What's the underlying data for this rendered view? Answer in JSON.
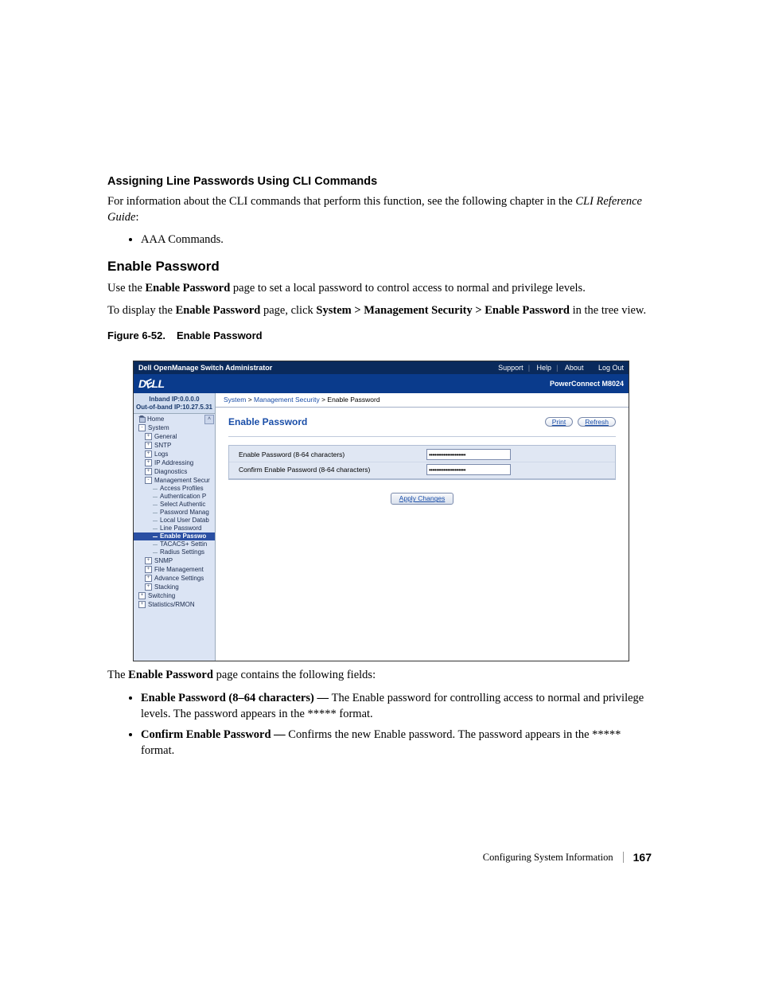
{
  "section1_heading": "Assigning Line Passwords Using CLI Commands",
  "section1_p1a": "For information about the CLI commands that perform this function, see the following chapter in the ",
  "section1_p1b": "CLI Reference Guide",
  "section1_p1c": ":",
  "section1_bullet1": "AAA Commands.",
  "section2_heading": "Enable Password",
  "section2_p1a": "Use the ",
  "section2_p1b": "Enable Password",
  "section2_p1c": " page to set a local password to control access to normal and privilege levels.",
  "section2_p2a": "To display the ",
  "section2_p2b": "Enable Password",
  "section2_p2c": " page, click ",
  "section2_p2d": "System > Management Security > Enable Password",
  "section2_p2e": " in the tree view.",
  "figcap_a": "Figure 6-52.",
  "figcap_b": "Enable Password",
  "shot": {
    "topbar_title": "Dell OpenManage Switch Administrator",
    "top_links": {
      "support": "Support",
      "help": "Help",
      "about": "About",
      "logout": "Log Out"
    },
    "model": "PowerConnect M8024",
    "ip": {
      "inband": "Inband IP:0.0.0.0",
      "oob": "Out-of-band IP:10.27.5.31"
    },
    "tree": {
      "home": "Home",
      "system": "System",
      "general": "General",
      "sntp": "SNTP",
      "logs": "Logs",
      "ipaddr": "IP Addressing",
      "diag": "Diagnostics",
      "mgmtsec": "Management Secur",
      "access": "Access Profiles",
      "authp": "Authentication P",
      "selectauth": "Select Authentic",
      "pwdmgr": "Password Manag",
      "localuser": "Local User Datab",
      "linepwd": "Line Password",
      "enablepwd": "Enable Passwo",
      "tacacs": "TACACS+ Settin",
      "radius": "Radius Settings",
      "snmp": "SNMP",
      "filemgmt": "File Management",
      "advset": "Advance Settings",
      "stacking": "Stacking",
      "switching": "Switching",
      "stats": "Statistics/RMON"
    },
    "crumb": {
      "a": "System",
      "b": "Management Security",
      "c": "Enable Password"
    },
    "content": {
      "title": "Enable Password",
      "print": "Print",
      "refresh": "Refresh",
      "row1": "Enable Password (8-64 characters)",
      "row2": "Confirm Enable Password (8-64 characters)",
      "mask": "••••••••••••••••••••",
      "apply": "Apply Changes"
    }
  },
  "after_p1a": "The ",
  "after_p1b": "Enable Password",
  "after_p1c": " page contains the following fields:",
  "after_b1a": "Enable Password (8–64 characters) — ",
  "after_b1b": "The Enable password for controlling access to normal and privilege levels. The password appears in the ***** format.",
  "after_b2a": "Confirm Enable Password — ",
  "after_b2b": "Confirms the new Enable password. The password appears in the ***** format.",
  "footer_section": "Configuring System Information",
  "footer_page": "167"
}
